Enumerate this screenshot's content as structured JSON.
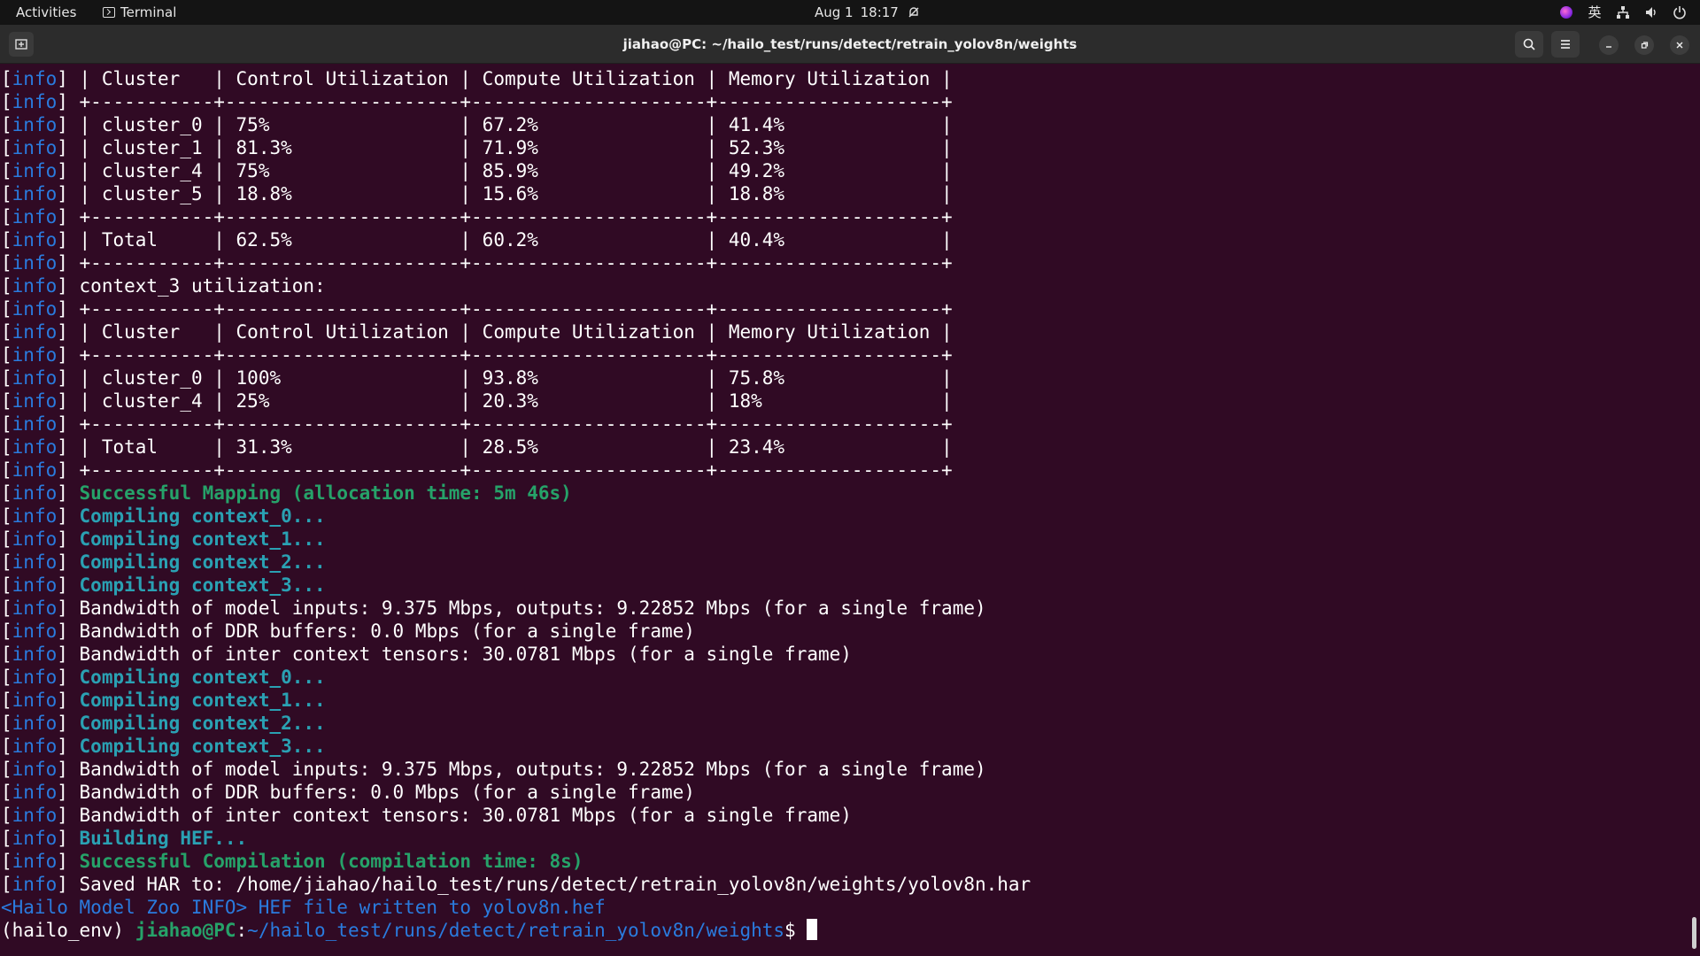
{
  "topbar": {
    "activities": "Activities",
    "app_name": "Terminal",
    "date": "Aug 1",
    "time": "18:17",
    "input_method": "英"
  },
  "window": {
    "title": "jiahao@PC: ~/hailo_test/runs/detect/retrain_yolov8n/weights"
  },
  "terminal": {
    "info_tag": "info",
    "lines": [
      {
        "cls": "w",
        "text": " | Cluster   | Control Utilization | Compute Utilization | Memory Utilization |"
      },
      {
        "cls": "w",
        "text": " +-----------+---------------------+---------------------+--------------------+"
      },
      {
        "cls": "w",
        "text": " | cluster_0 | 75%                 | 67.2%               | 41.4%              |"
      },
      {
        "cls": "w",
        "text": " | cluster_1 | 81.3%               | 71.9%               | 52.3%              |"
      },
      {
        "cls": "w",
        "text": " | cluster_4 | 75%                 | 85.9%               | 49.2%              |"
      },
      {
        "cls": "w",
        "text": " | cluster_5 | 18.8%               | 15.6%               | 18.8%              |"
      },
      {
        "cls": "w",
        "text": " +-----------+---------------------+---------------------+--------------------+"
      },
      {
        "cls": "w",
        "text": " | Total     | 62.5%               | 60.2%               | 40.4%              |"
      },
      {
        "cls": "w",
        "text": " +-----------+---------------------+---------------------+--------------------+"
      },
      {
        "cls": "w",
        "text": " context_3 utilization:"
      },
      {
        "cls": "w",
        "text": " +-----------+---------------------+---------------------+--------------------+"
      },
      {
        "cls": "w",
        "text": " | Cluster   | Control Utilization | Compute Utilization | Memory Utilization |"
      },
      {
        "cls": "w",
        "text": " +-----------+---------------------+---------------------+--------------------+"
      },
      {
        "cls": "w",
        "text": " | cluster_0 | 100%                | 93.8%               | 75.8%              |"
      },
      {
        "cls": "w",
        "text": " | cluster_4 | 25%                 | 20.3%               | 18%                |"
      },
      {
        "cls": "w",
        "text": " +-----------+---------------------+---------------------+--------------------+"
      },
      {
        "cls": "w",
        "text": " | Total     | 31.3%               | 28.5%               | 23.4%              |"
      },
      {
        "cls": "w",
        "text": " +-----------+---------------------+---------------------+--------------------+"
      },
      {
        "cls": "g",
        "text": " Successful Mapping (allocation time: 5m 46s)"
      },
      {
        "cls": "c",
        "text": " Compiling context_0..."
      },
      {
        "cls": "c",
        "text": " Compiling context_1..."
      },
      {
        "cls": "c",
        "text": " Compiling context_2..."
      },
      {
        "cls": "c",
        "text": " Compiling context_3..."
      },
      {
        "cls": "w",
        "text": " Bandwidth of model inputs: 9.375 Mbps, outputs: 9.22852 Mbps (for a single frame)"
      },
      {
        "cls": "w",
        "text": " Bandwidth of DDR buffers: 0.0 Mbps (for a single frame)"
      },
      {
        "cls": "w",
        "text": " Bandwidth of inter context tensors: 30.0781 Mbps (for a single frame)"
      },
      {
        "cls": "c",
        "text": " Compiling context_0..."
      },
      {
        "cls": "c",
        "text": " Compiling context_1..."
      },
      {
        "cls": "c",
        "text": " Compiling context_2..."
      },
      {
        "cls": "c",
        "text": " Compiling context_3..."
      },
      {
        "cls": "w",
        "text": " Bandwidth of model inputs: 9.375 Mbps, outputs: 9.22852 Mbps (for a single frame)"
      },
      {
        "cls": "w",
        "text": " Bandwidth of DDR buffers: 0.0 Mbps (for a single frame)"
      },
      {
        "cls": "w",
        "text": " Bandwidth of inter context tensors: 30.0781 Mbps (for a single frame)"
      },
      {
        "cls": "c",
        "text": " Building HEF..."
      },
      {
        "cls": "g",
        "text": " Successful Compilation (compilation time: 8s)"
      },
      {
        "cls": "w",
        "text": " Saved HAR to: /home/jiahao/hailo_test/runs/detect/retrain_yolov8n/weights/yolov8n.har"
      }
    ],
    "zoo_line": "<Hailo Model Zoo INFO> HEF file written to yolov8n.hef",
    "prompt": {
      "env": "(hailo_env) ",
      "user_host": "jiahao@PC",
      "sep": ":",
      "path": "~/hailo_test/runs/detect/retrain_yolov8n/weights",
      "symbol": "$ "
    }
  },
  "colors": {
    "background": "#300a24",
    "info_tag": "#2a7bde",
    "success": "#26a269",
    "compiling": "#2aa1b3"
  }
}
